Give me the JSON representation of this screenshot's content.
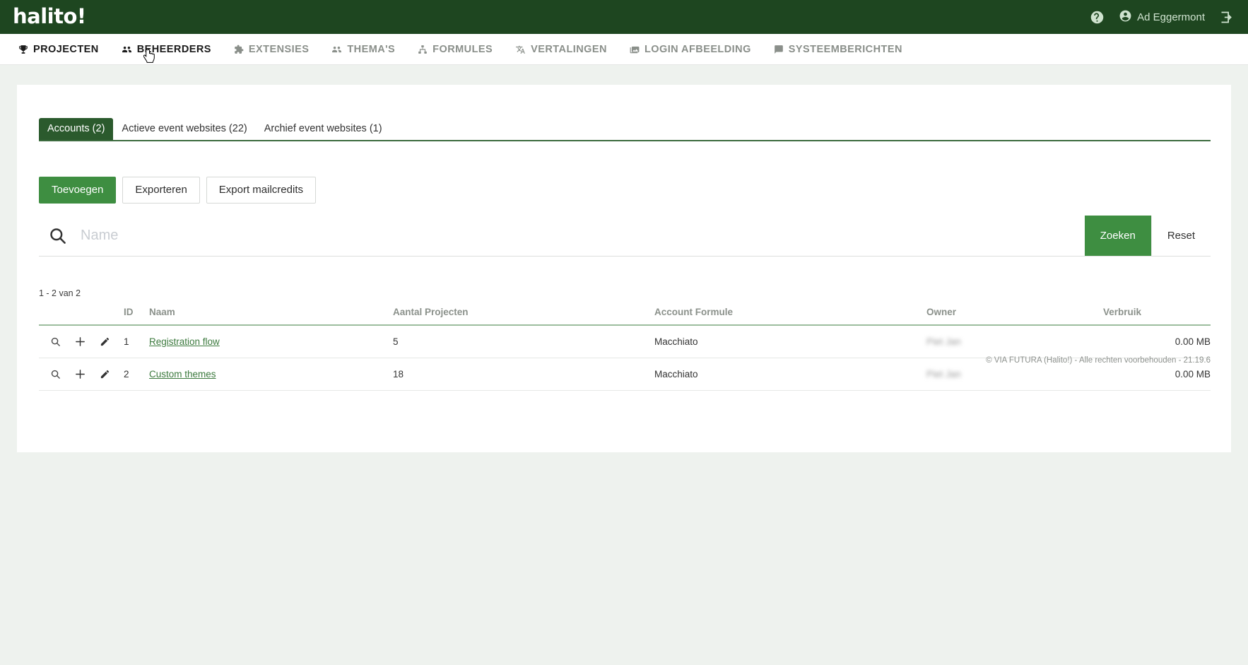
{
  "colors": {
    "header_green": "#1e4620",
    "accent_green": "#3e8e41",
    "tab_active_green": "#2b5a2d",
    "link_green": "#3c7a3e",
    "page_bg": "#eef2ee"
  },
  "header": {
    "logo": "halito!",
    "help_icon": "help-circle-icon",
    "user_icon": "account-circle-icon",
    "user_name": "Ad Eggermont",
    "logout_icon": "logout-icon"
  },
  "nav": {
    "items": [
      {
        "label": "PROJECTEN",
        "icon": "trophy-icon",
        "active": true
      },
      {
        "label": "BEHEERDERS",
        "icon": "people-icon",
        "active": true
      },
      {
        "label": "EXTENSIES",
        "icon": "puzzle-icon",
        "active": false
      },
      {
        "label": "THEMA'S",
        "icon": "group-icon",
        "active": false
      },
      {
        "label": "FORMULES",
        "icon": "sitemap-icon",
        "active": false
      },
      {
        "label": "VERTALINGEN",
        "icon": "translate-icon",
        "active": false
      },
      {
        "label": "LOGIN AFBEELDING",
        "icon": "image-icon",
        "active": false
      },
      {
        "label": "SYSTEEMBERICHTEN",
        "icon": "message-icon",
        "active": false
      }
    ]
  },
  "tabs": [
    {
      "label": "Accounts (2)",
      "active": true
    },
    {
      "label": "Actieve event websites (22)",
      "active": false
    },
    {
      "label": "Archief event websites (1)",
      "active": false
    }
  ],
  "actions": {
    "add_label": "Toevoegen",
    "export_label": "Exporteren",
    "export_mailcredits_label": "Export mailcredits"
  },
  "search": {
    "icon": "search-icon",
    "value": "",
    "placeholder": "Name",
    "submit_label": "Zoeken",
    "reset_label": "Reset"
  },
  "table": {
    "result_count": "1 - 2 van 2",
    "columns": [
      "",
      "ID",
      "Naam",
      "Aantal Projecten",
      "Account Formule",
      "Owner",
      "Verbruik"
    ],
    "row_icons": [
      "magnify-icon",
      "plus-icon",
      "pencil-icon"
    ],
    "rows": [
      {
        "id": "1",
        "naam": "Registration flow",
        "aantal_projecten": "5",
        "account_formule": "Macchiato",
        "owner": "Piet Jan",
        "verbruik": "0.00 MB"
      },
      {
        "id": "2",
        "naam": "Custom themes",
        "aantal_projecten": "18",
        "account_formule": "Macchiato",
        "owner": "Piet Jan",
        "verbruik": "0.00 MB"
      }
    ]
  },
  "footer": {
    "copyright": "© VIA FUTURA (Halito!) - Alle rechten voorbehouden - 21.19.6"
  }
}
